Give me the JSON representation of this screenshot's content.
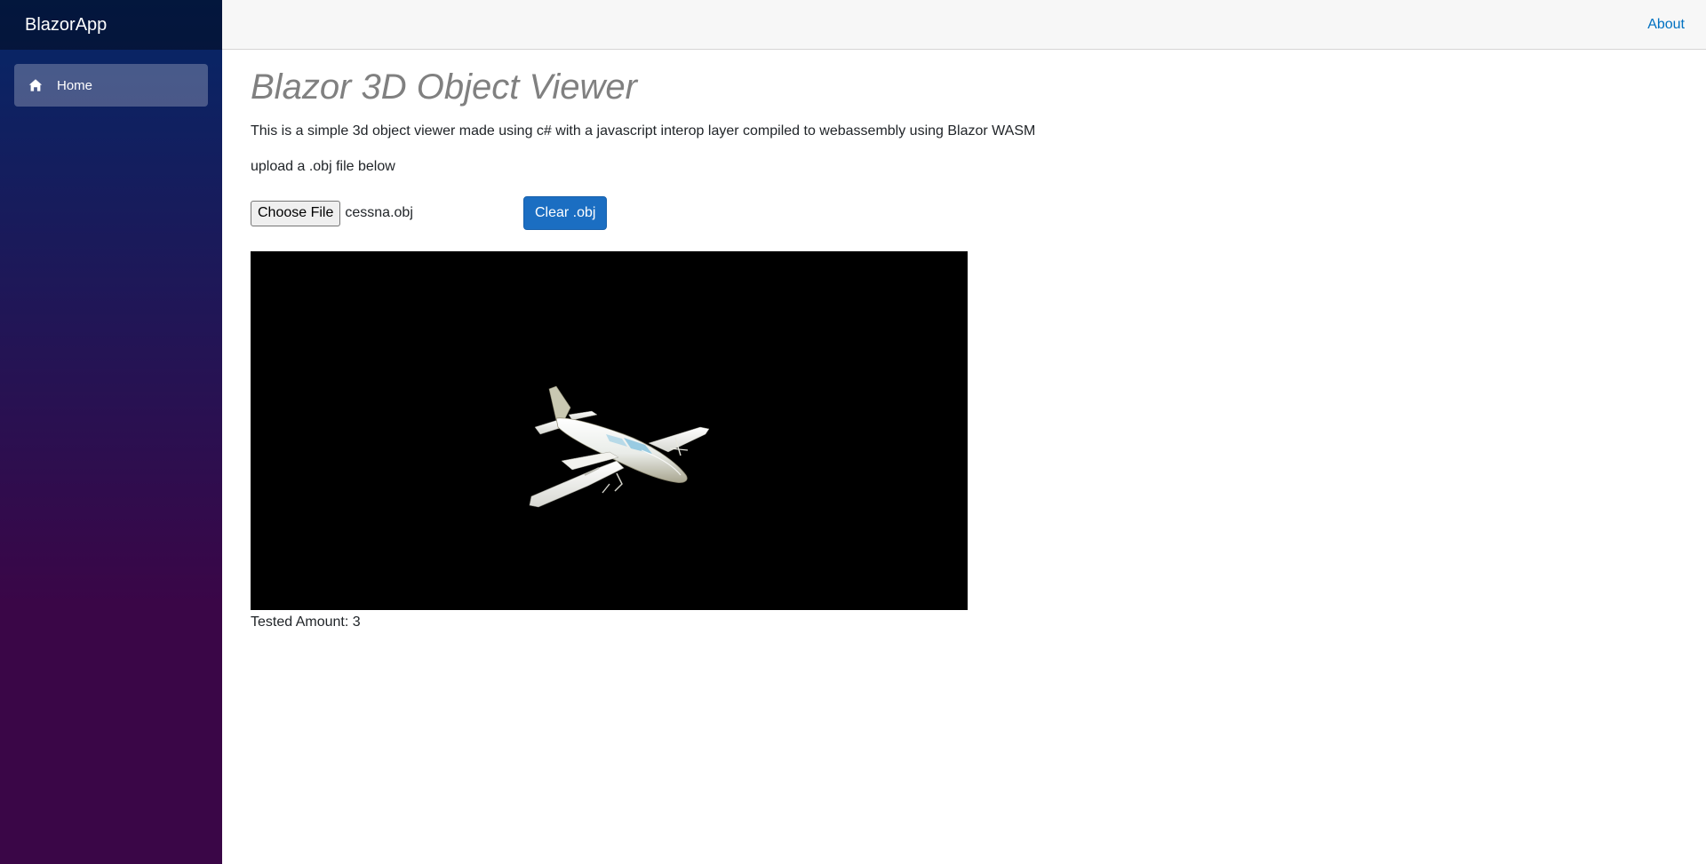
{
  "app": {
    "brand": "BlazorApp"
  },
  "sidebar": {
    "items": [
      {
        "label": "Home",
        "icon": "home-icon",
        "active": true
      }
    ]
  },
  "topbar": {
    "about_label": "About"
  },
  "page": {
    "title": "Blazor 3D Object Viewer",
    "description": "This is a simple 3d object viewer made using c# with a javascript interop layer compiled to webassembly using Blazor WASM",
    "upload_instruction": "upload a .obj file below"
  },
  "file_input": {
    "button_label": "Choose File",
    "selected_file": "cessna.obj"
  },
  "clear_button": {
    "label": "Clear .obj"
  },
  "viewer": {
    "model": "cessna-airplane",
    "background": "#000000"
  },
  "tested": {
    "label": "Tested Amount: 3"
  },
  "colors": {
    "sidebar_top": "#052767",
    "sidebar_bottom": "#3a0647",
    "accent_button": "#1b6ec2",
    "link": "#0071c1",
    "title_gray": "#808080"
  }
}
